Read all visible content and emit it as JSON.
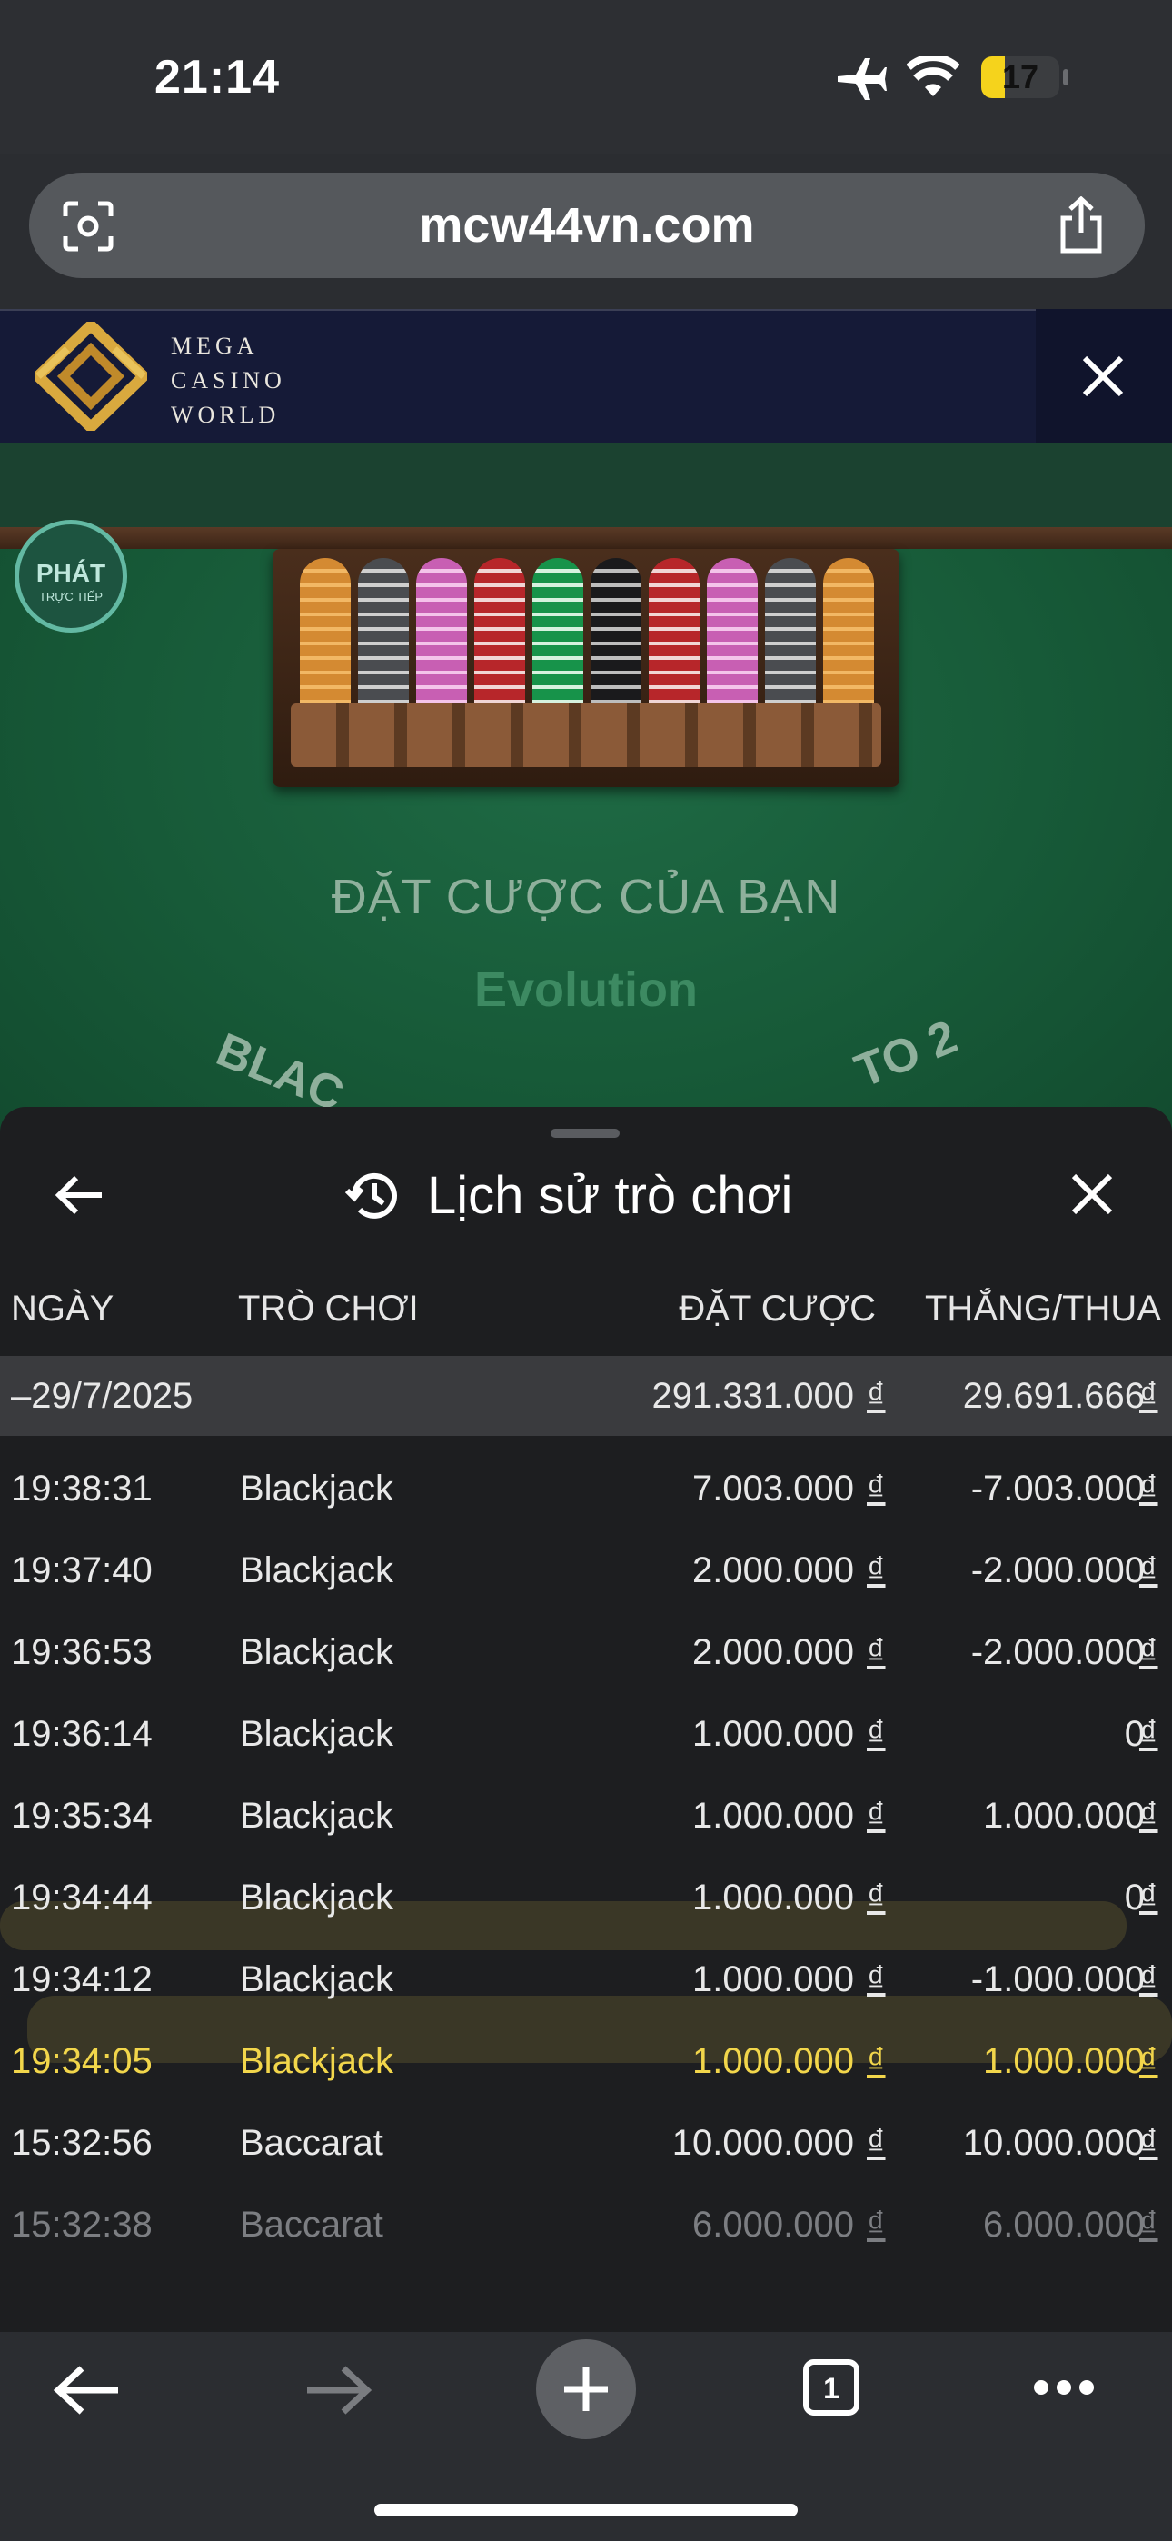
{
  "status_bar": {
    "time": "21:14",
    "battery": "17"
  },
  "browser": {
    "url": "mcw44vn.com"
  },
  "banner": {
    "brand_line1": "MEGA",
    "brand_line2": "CASINO",
    "brand_line3": "WORLD"
  },
  "game": {
    "live_badge_line1": "PHÁT",
    "live_badge_line2": "TRỰC TIẾP",
    "bet_prompt": "ĐẶT CƯỢC CỦA BẠN",
    "provider": "Evolution",
    "arc_left": "BLAC",
    "arc_right": "TO 2"
  },
  "history": {
    "title": "Lịch sử trò chơi",
    "columns": {
      "date": "NGÀY",
      "game": "TRÒ CHƠI",
      "bet": "ĐẶT CƯỢC",
      "winloss": "THẮNG/THUA"
    },
    "date_group": {
      "date": "–29/7/2025",
      "bet": "291.331.000",
      "winloss": "29.691.666"
    },
    "currency": "₫",
    "rows": [
      {
        "time": "19:38:31",
        "game": "Blackjack",
        "bet": "7.003.000",
        "winloss": "-7.003.000"
      },
      {
        "time": "19:37:40",
        "game": "Blackjack",
        "bet": "2.000.000",
        "winloss": "-2.000.000"
      },
      {
        "time": "19:36:53",
        "game": "Blackjack",
        "bet": "2.000.000",
        "winloss": "-2.000.000"
      },
      {
        "time": "19:36:14",
        "game": "Blackjack",
        "bet": "1.000.000",
        "winloss": "0"
      },
      {
        "time": "19:35:34",
        "game": "Blackjack",
        "bet": "1.000.000",
        "winloss": "1.000.000"
      },
      {
        "time": "19:34:44",
        "game": "Blackjack",
        "bet": "1.000.000",
        "winloss": "0"
      },
      {
        "time": "19:34:12",
        "game": "Blackjack",
        "bet": "1.000.000",
        "winloss": "-1.000.000"
      },
      {
        "time": "19:34:05",
        "game": "Blackjack",
        "bet": "1.000.000",
        "winloss": "1.000.000"
      },
      {
        "time": "15:32:56",
        "game": "Baccarat",
        "bet": "10.000.000",
        "winloss": "10.000.000"
      },
      {
        "time": "15:32:38",
        "game": "Baccarat",
        "bet": "6.000.000",
        "winloss": "6.000.000"
      }
    ]
  },
  "toolbar": {
    "tab_count": "1"
  },
  "colors": {
    "highlight": "#f2d64b",
    "felt": "#1a6340",
    "sheet_bg": "#1d1e20"
  }
}
